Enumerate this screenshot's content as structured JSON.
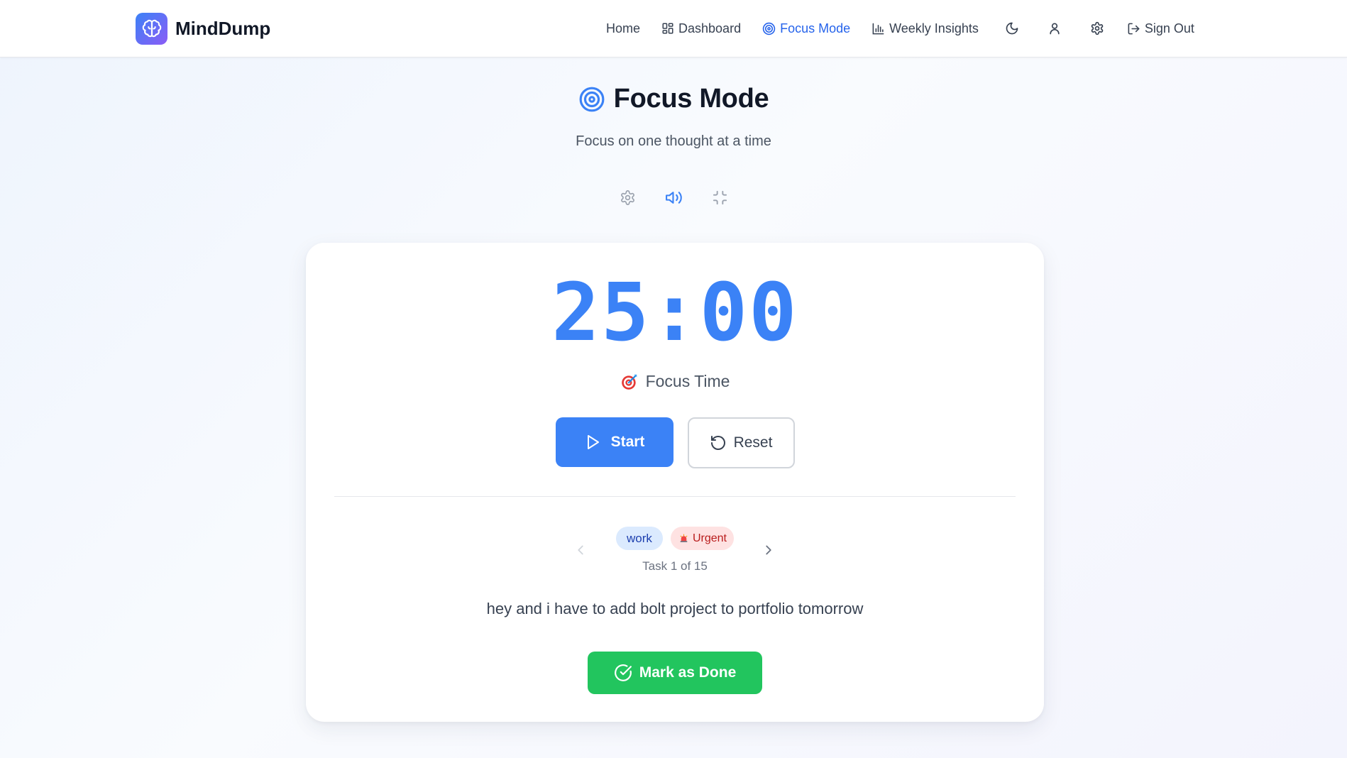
{
  "brand": {
    "name": "MindDump",
    "logo_icon": "brain-icon",
    "gradient_from": "#3b82f6",
    "gradient_to": "#8b5cf6"
  },
  "nav": {
    "items": [
      {
        "label": "Home",
        "icon": "",
        "active": false
      },
      {
        "label": "Dashboard",
        "icon": "grid-icon",
        "active": false
      },
      {
        "label": "Focus Mode",
        "icon": "target-icon",
        "active": true
      },
      {
        "label": "Weekly Insights",
        "icon": "bar-chart-icon",
        "active": false
      }
    ],
    "icon_buttons": [
      "moon-icon",
      "user-icon",
      "gear-icon"
    ],
    "sign_out_label": "Sign Out"
  },
  "page": {
    "title": "Focus Mode",
    "subtitle": "Focus on one thought at a time",
    "toolbar_icons": [
      "gear-icon",
      "volume-icon",
      "minimize-icon"
    ]
  },
  "timer": {
    "minutes": "25",
    "separator": ":",
    "seconds": "00",
    "display": "25:00",
    "mode_label": "Focus Time",
    "mode_icon": "direct-hit-emoji",
    "start_label": "Start",
    "reset_label": "Reset"
  },
  "task": {
    "tags": [
      {
        "label": "work",
        "kind": "category"
      },
      {
        "label": "Urgent",
        "kind": "priority",
        "icon": "siren-emoji"
      }
    ],
    "counter": "Task 1 of 15",
    "current_index": 1,
    "total": 15,
    "text": "hey and i have to add bolt project to portfolio tomorrow",
    "done_label": "Mark as Done"
  },
  "colors": {
    "accent": "#3b82f6",
    "active_nav": "#2563eb",
    "success": "#22c55e",
    "tag_work_bg": "#dbeafe",
    "tag_urgent_bg": "#fee2e2"
  }
}
